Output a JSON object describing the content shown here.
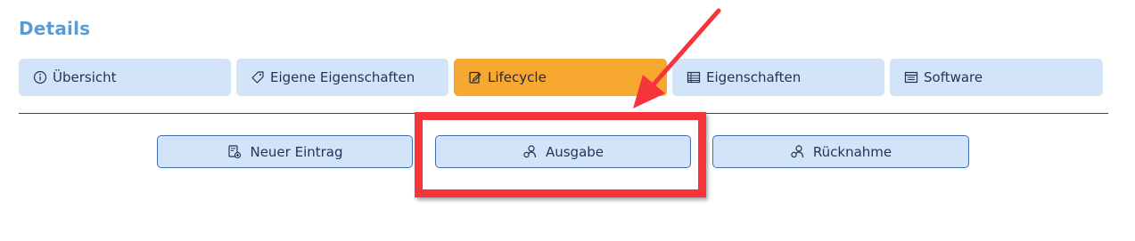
{
  "section_title": "Details",
  "tabs": [
    {
      "label": "Übersicht",
      "icon": "info-circle-icon",
      "active": false
    },
    {
      "label": "Eigene Eigenschaften",
      "icon": "tag-icon",
      "active": false
    },
    {
      "label": "Lifecycle",
      "icon": "edit-note-icon",
      "active": true
    },
    {
      "label": "Eigenschaften",
      "icon": "table-icon",
      "active": false
    },
    {
      "label": "Software",
      "icon": "list-window-icon",
      "active": false
    }
  ],
  "actions": [
    {
      "label": "Neuer Eintrag",
      "icon": "new-entry-icon"
    },
    {
      "label": "Ausgabe",
      "icon": "user-handout-icon"
    },
    {
      "label": "Rücknahme",
      "icon": "user-return-icon"
    }
  ],
  "annotation": {
    "color": "#f5353b"
  },
  "colors": {
    "tab_bg": "#d3e3f8",
    "tab_active_bg": "#f7a831",
    "title": "#5b9bd5",
    "text": "#1f3556"
  }
}
